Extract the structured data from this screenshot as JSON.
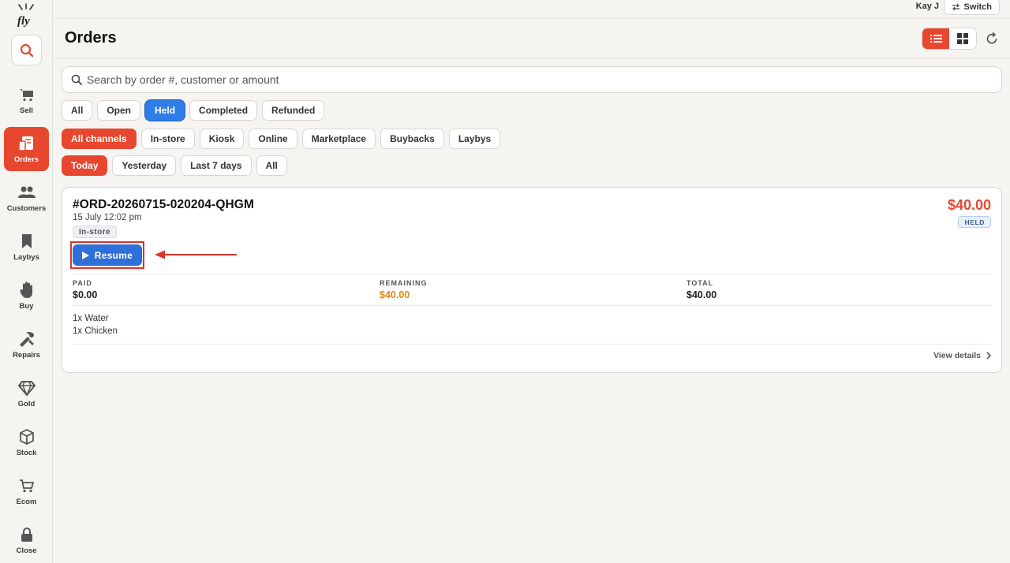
{
  "app": {
    "logo_text": "fly"
  },
  "topbar": {
    "user": "Kay J",
    "switch_label": "Switch"
  },
  "sidebar": {
    "items": [
      {
        "label": "Sell",
        "icon": "cart-icon"
      },
      {
        "label": "Orders",
        "icon": "orders-icon",
        "active": true
      },
      {
        "label": "Customers",
        "icon": "customers-icon"
      },
      {
        "label": "Laybys",
        "icon": "bookmark-icon"
      },
      {
        "label": "Buy",
        "icon": "hand-icon"
      },
      {
        "label": "Repairs",
        "icon": "tools-icon"
      },
      {
        "label": "Gold",
        "icon": "diamond-icon"
      },
      {
        "label": "Stock",
        "icon": "box-icon"
      },
      {
        "label": "Ecom",
        "icon": "ecom-cart-icon"
      },
      {
        "label": "Close",
        "icon": "lock-icon"
      }
    ]
  },
  "header": {
    "title": "Orders"
  },
  "search": {
    "placeholder": "Search by order #, customer or amount"
  },
  "filters": {
    "status": [
      "All",
      "Open",
      "Held",
      "Completed",
      "Refunded"
    ],
    "status_selected": "Held",
    "channels": [
      "All channels",
      "In-store",
      "Kiosk",
      "Online",
      "Marketplace",
      "Buybacks",
      "Laybys"
    ],
    "channel_selected": "All channels",
    "dates": [
      "Today",
      "Yesterday",
      "Last 7 days",
      "All"
    ],
    "date_selected": "Today"
  },
  "order": {
    "id": "#ORD-20260715-020204-QHGM",
    "date": "15 July 12:02 pm",
    "channel": "In-store",
    "amount": "$40.00",
    "status": "HELD",
    "resume_label": "Resume",
    "paid_label": "PAID",
    "paid_value": "$0.00",
    "remaining_label": "REMAINING",
    "remaining_value": "$40.00",
    "total_label": "TOTAL",
    "total_value": "$40.00",
    "items": [
      "1x Water",
      "1x Chicken"
    ],
    "view_details_label": "View details"
  },
  "colors": {
    "accent": "#e8472f",
    "primary_blue": "#2f6fd8",
    "remaining": "#d98a1c"
  }
}
